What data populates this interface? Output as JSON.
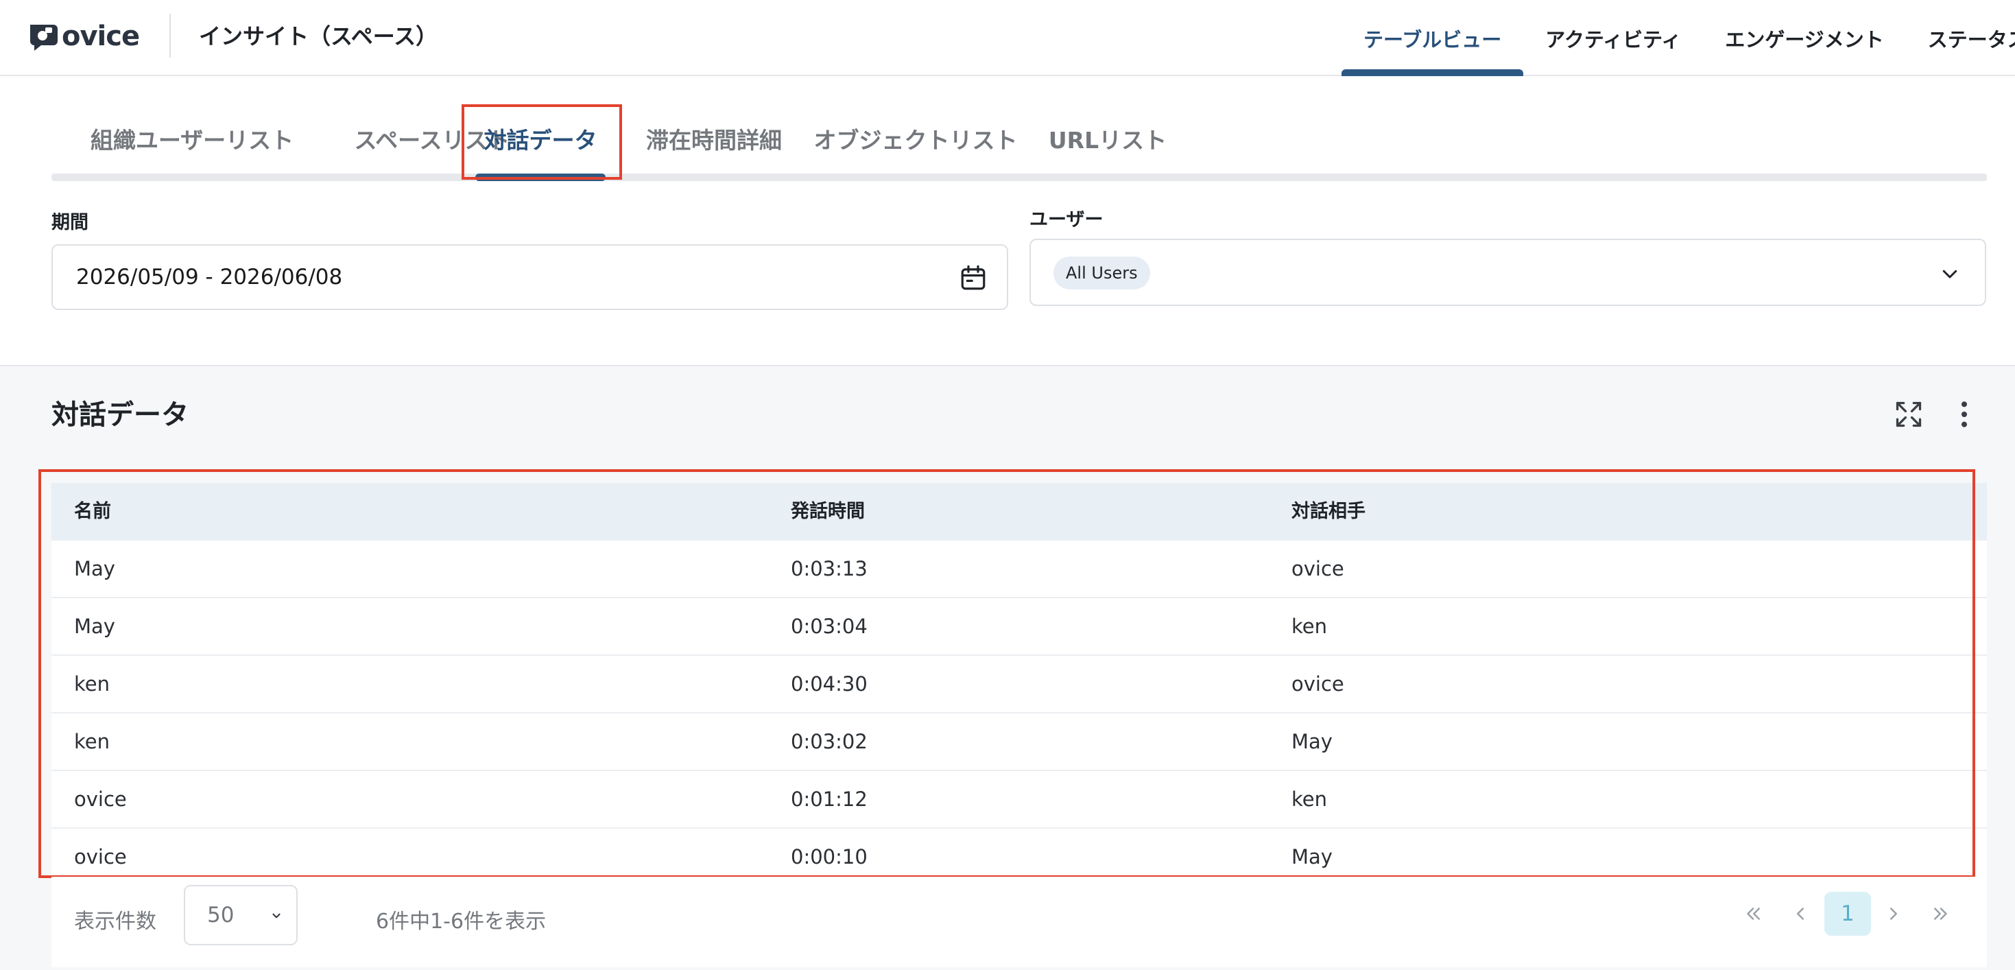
{
  "header": {
    "logo_text": "ovice",
    "app_title": "インサイト（スペース）",
    "nav": [
      {
        "label": "テーブルビュー",
        "active": true
      },
      {
        "label": "アクティビティ",
        "active": false
      },
      {
        "label": "エンゲージメント",
        "active": false
      },
      {
        "label": "ステータス",
        "active": false
      }
    ]
  },
  "tabs": [
    {
      "label": "組織ユーザーリスト",
      "active": false
    },
    {
      "label": "スペースリスト",
      "active": false
    },
    {
      "label": "対話データ",
      "active": true
    },
    {
      "label": "滞在時間詳細",
      "active": false
    },
    {
      "label": "オブジェクトリスト",
      "active": false
    },
    {
      "label": "URLリスト",
      "active": false
    }
  ],
  "filters": {
    "period_label": "期間",
    "period_value": "2026/05/09 - 2026/06/08",
    "user_label": "ユーザー",
    "user_chip": "All Users"
  },
  "panel": {
    "title": "対話データ",
    "columns": [
      "名前",
      "発話時間",
      "対話相手"
    ],
    "rows": [
      [
        "May",
        "0:03:13",
        "ovice"
      ],
      [
        "May",
        "0:03:04",
        "ken"
      ],
      [
        "ken",
        "0:04:30",
        "ovice"
      ],
      [
        "ken",
        "0:03:02",
        "May"
      ],
      [
        "ovice",
        "0:01:12",
        "ken"
      ],
      [
        "ovice",
        "0:00:10",
        "May"
      ]
    ]
  },
  "pagination": {
    "page_size_label": "表示件数",
    "page_size": "50",
    "range_text": "6件中1-6件を表示",
    "current_page": "1"
  },
  "colors": {
    "accent": "#2e5884",
    "highlight": "#e2422e",
    "table_header_bg": "#e8eff5",
    "current_page_bg": "#d9f1f6"
  }
}
